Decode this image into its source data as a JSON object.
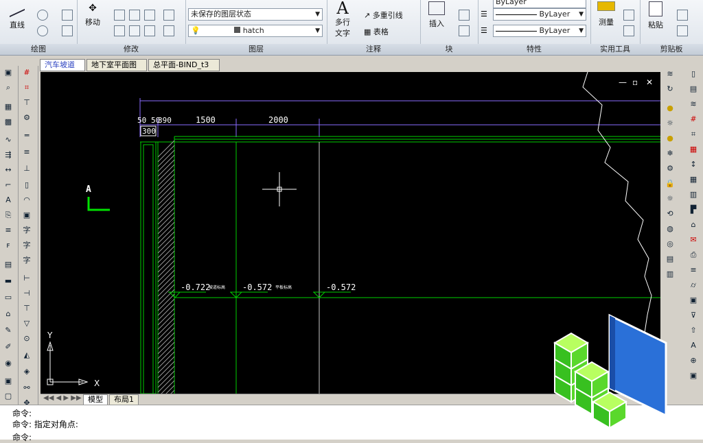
{
  "ribbon": {
    "draw": {
      "title": "绘图",
      "line_label": "直线"
    },
    "modify": {
      "title": "修改",
      "move_label": "移动"
    },
    "layers": {
      "title": "图层",
      "layer_state": "未保存的图层状态",
      "current_layer": "hatch"
    },
    "annotation": {
      "title": "注释",
      "mtext_label": "多行",
      "mtext_label2": "文字",
      "mleader_label": "多重引线",
      "table_label": "表格"
    },
    "block": {
      "title": "块",
      "insert_label": "插入"
    },
    "properties": {
      "title": "特性",
      "linetype1": "ByLayer",
      "linetype2": "ByLayer",
      "color": "ByLayer"
    },
    "utilities": {
      "title": "实用工具",
      "measure_label": "测量"
    },
    "clipboard": {
      "title": "剪贴板",
      "paste_label": "粘贴"
    }
  },
  "doc_tabs": [
    "汽车坡道",
    "地下室平面图",
    "总平面-BIND_t3"
  ],
  "drawing": {
    "dim_labels": [
      "50",
      "50",
      "390",
      "1500",
      "2000",
      "300"
    ],
    "elevations": [
      "-0.722",
      "-0.572",
      "-0.572"
    ],
    "elev_notes": [
      "坡道标高",
      "平板标高"
    ],
    "view_label": "A",
    "ucs_x": "X",
    "ucs_y": "Y",
    "window_controls": [
      "—",
      "▫",
      "✕"
    ]
  },
  "layout_tabs": [
    "模型",
    "布局1"
  ],
  "command": {
    "line1": "命令:",
    "line2": "命令: 指定对角点:",
    "line3": "命令:"
  },
  "colors": {
    "canvas_bg": "#000000",
    "green": "#00d000",
    "purple": "#8a6cff",
    "white": "#ffffff"
  }
}
